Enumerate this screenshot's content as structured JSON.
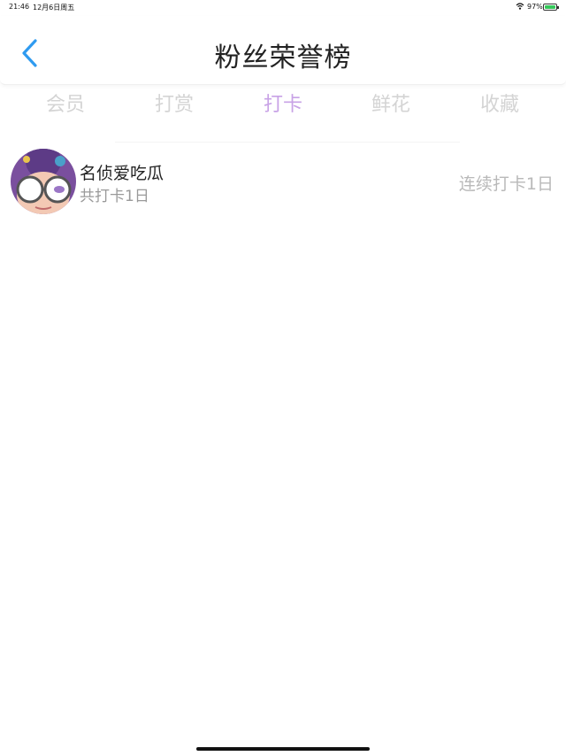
{
  "status_bar": {
    "time": "21:46",
    "date": "12月6日周五",
    "battery_percent": "97%",
    "battery_level": 0.97,
    "battery_color": "#35c759"
  },
  "header": {
    "back_icon": "chevron-left-icon",
    "title": "粉丝荣誉榜",
    "back_color": "#2f9bf0"
  },
  "tabs": [
    {
      "label": "会员",
      "active": false
    },
    {
      "label": "打赏",
      "active": false
    },
    {
      "label": "打卡",
      "active": true
    },
    {
      "label": "鲜花",
      "active": false
    },
    {
      "label": "收藏",
      "active": false
    }
  ],
  "active_tab_color": "#c8a2e6",
  "list": {
    "items": [
      {
        "name": "名侦爱吃瓜",
        "total": "共打卡1日",
        "streak": "连续打卡1日",
        "avatar_icon": "user-avatar-icon"
      }
    ]
  }
}
